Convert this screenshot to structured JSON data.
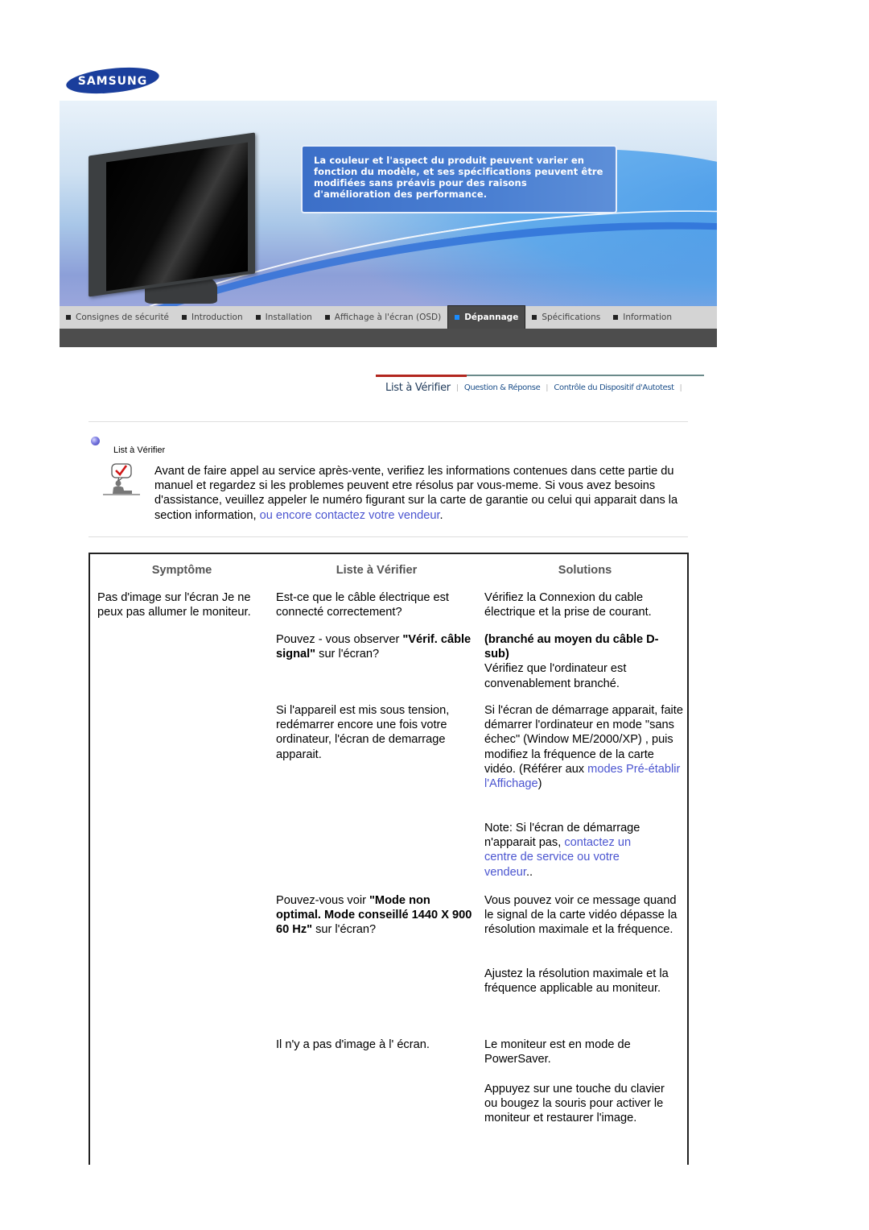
{
  "brand": {
    "logo_text": "SAMSUNG",
    "logo_color": "#1a3e9c"
  },
  "banner": {
    "notice_text": "La couleur et l'aspect du produit peuvent varier en fonction du modèle, et ses spécifications peuvent être modifiées sans préavis pour des raisons d'amélioration des performance."
  },
  "nav": {
    "items": [
      {
        "label": "Consignes de sécurité",
        "active": false
      },
      {
        "label": "Introduction",
        "active": false
      },
      {
        "label": "Installation",
        "active": false
      },
      {
        "label": "Affichage à l'écran (OSD)",
        "active": false
      },
      {
        "label": "Dépannage",
        "active": true
      },
      {
        "label": "Spécifications",
        "active": false
      },
      {
        "label": "Information",
        "active": false
      }
    ],
    "active_marker_color": "#1a8cff"
  },
  "subtabs": {
    "items": [
      {
        "label": "List à Vérifier",
        "active": true
      },
      {
        "label": "Question & Réponse",
        "active": false
      },
      {
        "label": "Contrôle du Dispositif d'Autotest",
        "active": false
      }
    ],
    "active_color": "#b2261e"
  },
  "section": {
    "title": "List à Vérifier",
    "intro_text": "Avant de faire appel au service après-vente, verifiez les informations contenues dans cette partie du manuel et regardez si les problemes peuvent etre résolus par vous-meme. Si vous avez besoins d'assistance, veuillez appeler le numéro figurant sur la carte de garantie ou celui qui apparait dans la section information, ",
    "intro_link": "ou encore contactez votre vendeur",
    "intro_end": ".",
    "link_color": "#4b55d0"
  },
  "table": {
    "headers": {
      "symptom": "Symptôme",
      "check": "Liste à Vérifier",
      "solutions": "Solutions"
    },
    "symptom": "Pas d'image sur l'écran Je ne peux pas allumer le moniteur.",
    "rows": [
      {
        "check": "Est-ce que le câble électrique est connecté correctement?",
        "solution": "Vérifiez la Connexion du cable électrique et la prise de courant."
      },
      {
        "check_pre": "Pouvez - vous observer ",
        "check_bold": "\"Vérif. câble signal\"",
        "check_post": " sur l'écran?",
        "solution_bold": "(branché au moyen du câble D-sub)",
        "solution": "Vérifiez que l'ordinateur est convenablement branché."
      },
      {
        "check": "Si l'appareil est mis sous tension, redémarrer encore une fois votre ordinateur, l'écran de demarrage apparait.",
        "solution_pre": "Si l'écran de démarrage apparait, faite démarrer l'ordinateur en mode \"sans échec\" (Window ME/2000/XP) , puis modifiez la fréquence de la carte vidéo. (Référer aux ",
        "solution_link": "modes Pré-établir l'Affichage",
        "solution_post": ")",
        "note_pre": "Note: Si l'écran de démarrage n'apparait pas, ",
        "note_link": "contactez un centre de service ou votre vendeur",
        "note_post": ".."
      },
      {
        "check_pre": "Pouvez-vous voir ",
        "check_bold": "\"Mode non optimal. Mode conseillé 1440 X 900 60 Hz\"",
        "check_post": " sur l'écran?",
        "solution": "Vous pouvez voir ce message quand le signal de la carte vidéo dépasse la résolution maximale et la fréquence.",
        "solution2": "Ajustez la résolution maximale et la fréquence applicable au moniteur."
      },
      {
        "check": "Il n'y a pas d'image à l' écran.",
        "solution": "Le moniteur est en mode de PowerSaver.",
        "solution2": "Appuyez sur une touche du clavier ou bougez la souris pour activer le moniteur et restaurer l'image."
      }
    ]
  }
}
